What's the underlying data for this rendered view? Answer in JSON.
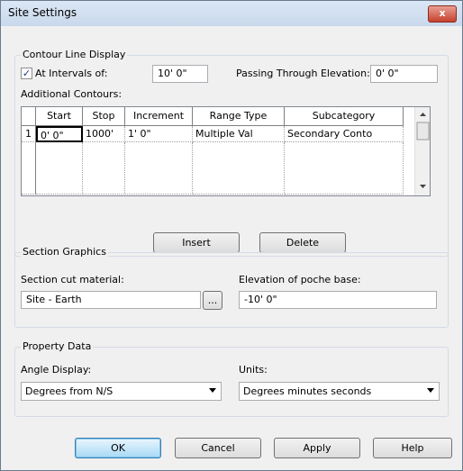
{
  "window": {
    "title": "Site Settings",
    "close_label": "x"
  },
  "contour": {
    "legend": "Contour Line Display",
    "at_intervals_label": "At Intervals of:",
    "at_intervals_checked": true,
    "interval_value": "10'  0\"",
    "passing_label": "Passing Through Elevation:",
    "passing_value": "0'  0\"",
    "additional_label": "Additional Contours:",
    "columns": [
      "Start",
      "Stop",
      "Increment",
      "Range Type",
      "Subcategory"
    ],
    "rows": [
      {
        "num": "1",
        "start": "0'  0\"",
        "stop": "1000'",
        "increment": "1'  0\"",
        "range_type": "Multiple Val",
        "subcategory": "Secondary Conto"
      }
    ],
    "insert_label": "Insert",
    "delete_label": "Delete"
  },
  "section": {
    "legend": "Section Graphics",
    "material_label": "Section cut material:",
    "material_value": "Site - Earth",
    "browse_label": "...",
    "poche_label": "Elevation of poche base:",
    "poche_value": "-10'  0\""
  },
  "property": {
    "legend": "Property Data",
    "angle_label": "Angle Display:",
    "angle_value": "Degrees from N/S",
    "units_label": "Units:",
    "units_value": "Degrees minutes seconds"
  },
  "buttons": {
    "ok": "OK",
    "cancel": "Cancel",
    "apply": "Apply",
    "help": "Help"
  },
  "colors": {
    "titlebar": "#c9d8ec",
    "close": "#c7412d",
    "default_button": "#a7d9f5"
  }
}
